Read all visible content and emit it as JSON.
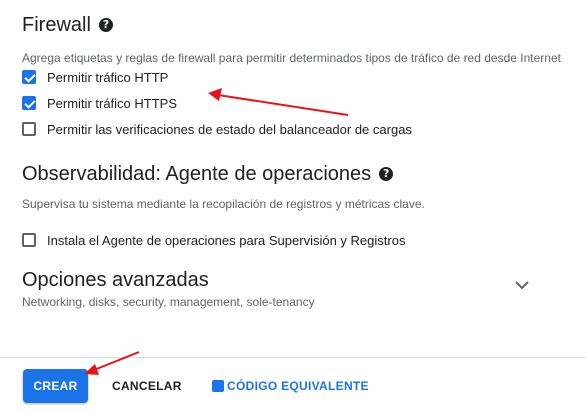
{
  "firewall": {
    "title": "Firewall",
    "help_icon": "help-circle-icon",
    "description": "Agrega etiquetas y reglas de firewall para permitir determinados tipos de tráfico de red desde Internet",
    "options": [
      {
        "label": "Permitir tráfico HTTP",
        "checked": true
      },
      {
        "label": "Permitir tráfico HTTPS",
        "checked": true
      },
      {
        "label": "Permitir las verificaciones de estado del balanceador de cargas",
        "checked": false
      }
    ]
  },
  "observability": {
    "title": "Observabilidad: Agente de operaciones",
    "help_icon": "help-circle-icon",
    "description": "Supervisa tu sistema mediante la recopilación de registros y métricas clave.",
    "options": [
      {
        "label": "Instala el Agente de operaciones para Supervisión y Registros",
        "checked": false
      }
    ]
  },
  "advanced": {
    "title": "Opciones avanzadas",
    "subtitle": "Networking, disks, security, management, sole-tenancy",
    "expand_icon": "chevron-down-icon"
  },
  "footer": {
    "create_label": "CREAR",
    "cancel_label": "CANCELAR",
    "code_label": "CÓDIGO EQUIVALENTE",
    "code_icon": "code-icon"
  },
  "colors": {
    "accent": "#1a73e8",
    "annotation_arrow": "#e8141b"
  }
}
